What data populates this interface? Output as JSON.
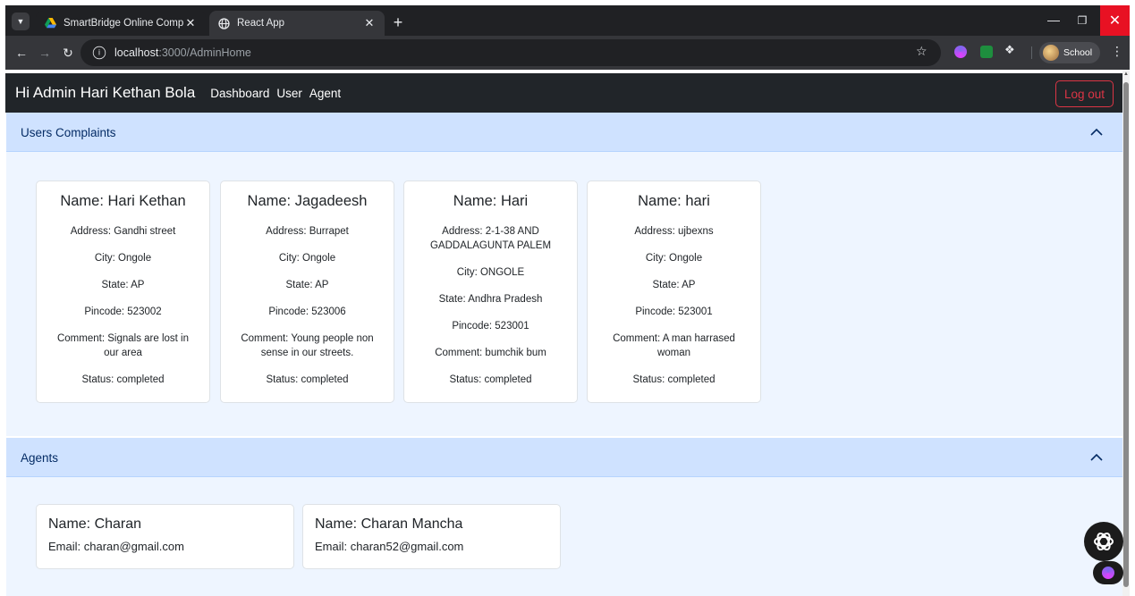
{
  "browser": {
    "tabs": [
      {
        "title": "SmartBridge Online Complaints",
        "icon": "google-drive-icon",
        "active": false
      },
      {
        "title": "React App",
        "icon": "globe-icon",
        "active": true
      }
    ],
    "url": {
      "host": "localhost",
      "path": ":3000/AdminHome"
    },
    "profile_label": "School"
  },
  "navbar": {
    "brand": "Hi Admin Hari Kethan Bola",
    "links": [
      "Dashboard",
      "User",
      "Agent"
    ],
    "logout_label": "Log out"
  },
  "complaints_section": {
    "title": "Users Complaints",
    "cards": [
      {
        "name": "Name: Hari Kethan",
        "address": "Address: Gandhi street",
        "city": "City: Ongole",
        "state": "State: AP",
        "pincode": "Pincode: 523002",
        "comment": "Comment: Signals are lost in our area",
        "status": "Status: completed"
      },
      {
        "name": "Name: Jagadeesh",
        "address": "Address: Burrapet",
        "city": "City: Ongole",
        "state": "State: AP",
        "pincode": "Pincode: 523006",
        "comment": "Comment: Young people non sense in our streets.",
        "status": "Status: completed"
      },
      {
        "name": "Name: Hari",
        "address": "Address: 2-1-38 AND GADDALAGUNTA PALEM",
        "city": "City: ONGOLE",
        "state": "State: Andhra Pradesh",
        "pincode": "Pincode: 523001",
        "comment": "Comment: bumchik bum",
        "status": "Status: completed"
      },
      {
        "name": "Name: hari",
        "address": "Address: ujbexns",
        "city": "City: Ongole",
        "state": "State: AP",
        "pincode": "Pincode: 523001",
        "comment": "Comment: A man harrased woman",
        "status": "Status: completed"
      }
    ]
  },
  "agents_section": {
    "title": "Agents",
    "cards": [
      {
        "name": "Name: Charan",
        "email": "Email: charan@gmail.com"
      },
      {
        "name": "Name: Charan Mancha",
        "email": "Email: charan52@gmail.com"
      }
    ]
  },
  "colors": {
    "navbar_bg": "#212529",
    "accordion_header_bg": "#cfe2ff",
    "accordion_body_bg": "#eef5ff",
    "logout_red": "#dc3545"
  }
}
